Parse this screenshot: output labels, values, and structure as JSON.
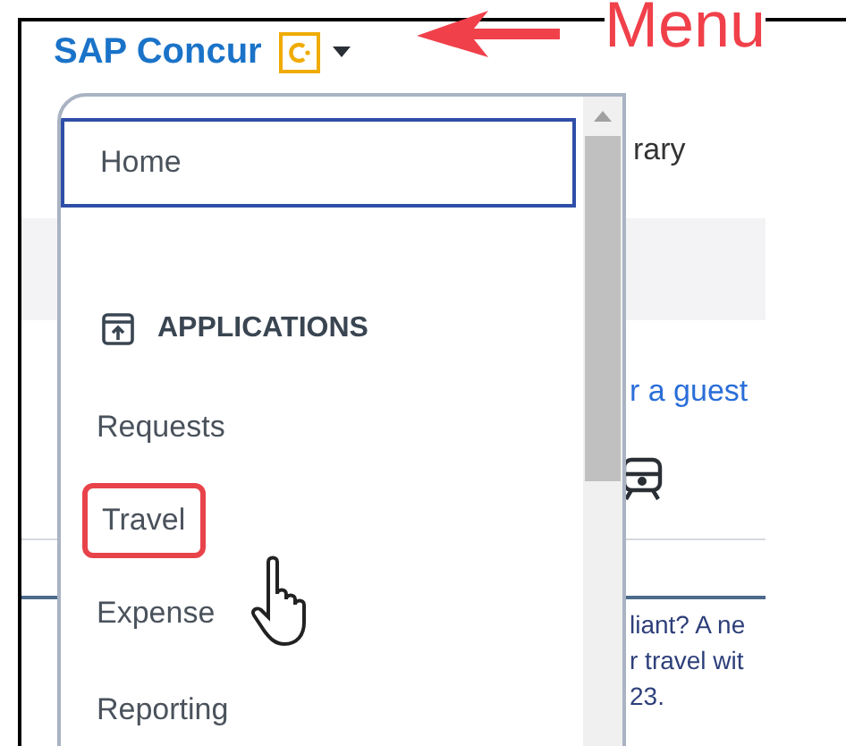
{
  "header": {
    "logo_text": "SAP Concur"
  },
  "annotation": {
    "label": "Menu"
  },
  "background_page": {
    "tab_fragment": "rary",
    "link_fragment": "r a guest",
    "notice_lines": [
      "liant? A ne",
      "r travel wit",
      "23."
    ]
  },
  "menu": {
    "items": [
      {
        "kind": "link",
        "label": "Home",
        "selected": true,
        "highlighted": false
      },
      {
        "kind": "heading",
        "label": "APPLICATIONS"
      },
      {
        "kind": "link",
        "label": "Requests",
        "selected": false,
        "highlighted": false
      },
      {
        "kind": "link",
        "label": "Travel",
        "selected": false,
        "highlighted": true
      },
      {
        "kind": "link",
        "label": "Expense",
        "selected": false,
        "highlighted": false
      },
      {
        "kind": "link",
        "label": "Reporting",
        "selected": false,
        "highlighted": false
      }
    ]
  }
}
